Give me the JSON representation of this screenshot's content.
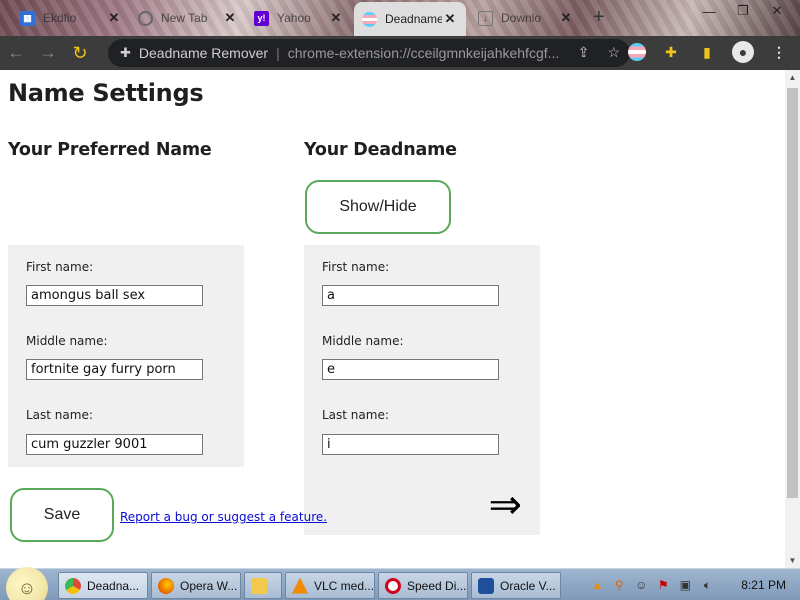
{
  "browser": {
    "tabs": [
      {
        "label": "Ekdfio",
        "icon": "window-icon",
        "color": "#2f6fd6"
      },
      {
        "label": "New Tab",
        "icon": "chrome-icon",
        "color": "#777777"
      },
      {
        "label": "Yahoo",
        "icon": "yahoo-icon",
        "color": "#6001d2"
      },
      {
        "label": "Deadname",
        "icon": "trans-flag-icon",
        "color": "#5bcefa"
      },
      {
        "label": "Downlo",
        "icon": "download-icon",
        "color": "#999999"
      }
    ],
    "new_tab": "+",
    "window_controls": {
      "minimize": "—",
      "restore": "❐",
      "close": "✕"
    },
    "omnibox": {
      "extension_name": "Deadname Remover",
      "url": "chrome-extension://cceilgmnkeijahkehfcgf..."
    }
  },
  "page": {
    "title": "Name Settings",
    "preferred": {
      "heading": "Your Preferred Name",
      "first_label": "First name:",
      "first_value": "amongus ball sex",
      "middle_label": "Middle name:",
      "middle_value": "fortnite gay furry porn",
      "last_label": "Last name:",
      "last_value": "cum guzzler 9001"
    },
    "deadname": {
      "heading": "Your Deadname",
      "show_hide_label": "Show/Hide",
      "first_label": "First name:",
      "first_value": "a",
      "middle_label": "Middle name:",
      "middle_value": "e",
      "last_label": "Last name:",
      "last_value": "i",
      "arrow": "⇒"
    },
    "save_label": "Save",
    "report_link": "Report a bug or suggest a feature."
  },
  "taskbar": {
    "items": [
      {
        "label": "Deadna...",
        "icon": "chrome-icon",
        "color": "#dd4b39"
      },
      {
        "label": "Opera W...",
        "icon": "firefox-icon",
        "color": "#e66000"
      },
      {
        "label": "",
        "icon": "folder-icon",
        "color": "#f2c94c"
      },
      {
        "label": "VLC med...",
        "icon": "vlc-icon",
        "color": "#f08a00"
      },
      {
        "label": "Speed Di...",
        "icon": "opera-icon",
        "color": "#d0021b"
      },
      {
        "label": "Oracle V...",
        "icon": "virtualbox-icon",
        "color": "#1f4f9a"
      }
    ],
    "clock": "8:21 PM"
  }
}
